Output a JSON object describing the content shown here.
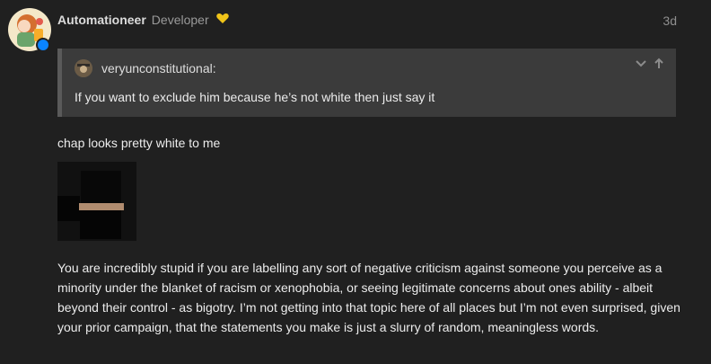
{
  "post": {
    "username": "Automationeer",
    "user_title": "Developer",
    "timestamp": "3d"
  },
  "quote": {
    "author": "veryunconstitutional:",
    "text": "If you want to exclude him because he’s not white then just say it"
  },
  "content": {
    "line1": "chap looks pretty white to me",
    "paragraph": "You are incredibly stupid if you are labelling any sort of negative criticism against someone you perceive as a minority under the blanket of racism or xenophobia, or seeing legitimate concerns about ones ability - albeit beyond their control - as bigotry. I’m not getting into that topic here of all places but I’m not even surprised, given your prior campaign, that the statements you make is just a slurry of random, meaningless words."
  },
  "icons": {
    "title_badge": "heart-icon",
    "quote_expand": "chevron-down-icon",
    "quote_jump": "arrow-up-icon",
    "avatar_badge": "roblox-badge-icon"
  },
  "colors": {
    "background": "#202020",
    "quote_background": "#3b3b3b",
    "heart": "#f0c419",
    "badge": "#0a84ff"
  }
}
